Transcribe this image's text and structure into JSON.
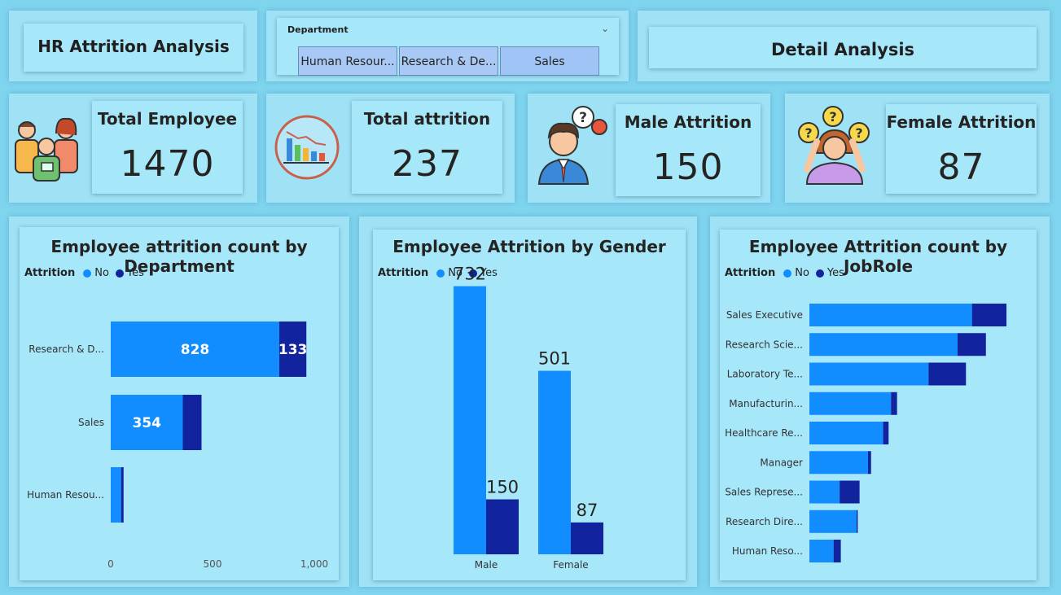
{
  "header": {
    "title": "HR Attrition Analysis",
    "detail_button": "Detail Analysis"
  },
  "slicer": {
    "label": "Department",
    "options": [
      "Human Resour...",
      "Research & De...",
      "Sales"
    ]
  },
  "kpis": [
    {
      "label": "Total Employee",
      "value": "1470",
      "icon": "team-icon"
    },
    {
      "label": "Total attrition",
      "value": "237",
      "icon": "declining-chart-icon"
    },
    {
      "label": "Male Attrition",
      "value": "150",
      "icon": "male-question-icon"
    },
    {
      "label": "Female Attrition",
      "value": "87",
      "icon": "female-question-icon"
    }
  ],
  "colors": {
    "no": "#118dff",
    "yes": "#12239e"
  },
  "charts": {
    "department": {
      "title": "Employee attrition count by Department",
      "legend_title": "Attrition",
      "legend": [
        "No",
        "Yes"
      ]
    },
    "gender": {
      "title": "Employee Attrition by Gender",
      "legend_title": "Attrition",
      "legend": [
        "No",
        "Yes"
      ]
    },
    "jobrole": {
      "title": "Employee Attrition count by JobRole",
      "legend_title": "Attrition",
      "legend": [
        "No",
        "Yes"
      ]
    }
  },
  "chart_data": [
    {
      "type": "bar",
      "orientation": "horizontal",
      "stacked": true,
      "title": "Employee attrition count by Department",
      "categories": [
        "Research & D...",
        "Sales",
        "Human Resou..."
      ],
      "series": [
        {
          "name": "No",
          "values": [
            828,
            354,
            51
          ]
        },
        {
          "name": "Yes",
          "values": [
            133,
            92,
            12
          ]
        }
      ],
      "data_labels": [
        [
          "828",
          "354",
          ""
        ],
        [
          "133",
          "",
          ""
        ]
      ],
      "xlim": [
        0,
        1000
      ],
      "xticks": [
        "0",
        "500",
        "1,000"
      ],
      "legend_title": "Attrition"
    },
    {
      "type": "bar",
      "orientation": "vertical",
      "stacked": false,
      "title": "Employee Attrition by Gender",
      "categories": [
        "Male",
        "Female"
      ],
      "series": [
        {
          "name": "No",
          "values": [
            732,
            501
          ]
        },
        {
          "name": "Yes",
          "values": [
            150,
            87
          ]
        }
      ],
      "data_labels": [
        [
          "732",
          "501"
        ],
        [
          "150",
          "87"
        ]
      ],
      "ylim": [
        0,
        800
      ],
      "legend_title": "Attrition"
    },
    {
      "type": "bar",
      "orientation": "horizontal",
      "stacked": true,
      "title": "Employee Attrition count by JobRole",
      "categories": [
        "Sales Executive",
        "Research Scie...",
        "Laboratory Te...",
        "Manufacturin...",
        "Healthcare Re...",
        "Manager",
        "Sales Represe...",
        "Research Dire...",
        "Human Reso..."
      ],
      "series": [
        {
          "name": "No",
          "values": [
            269,
            245,
            197,
            135,
            122,
            97,
            50,
            78,
            40
          ]
        },
        {
          "name": "Yes",
          "values": [
            57,
            47,
            62,
            10,
            9,
            5,
            33,
            2,
            12
          ]
        }
      ],
      "xlim": [
        0,
        330
      ],
      "legend_title": "Attrition"
    }
  ]
}
